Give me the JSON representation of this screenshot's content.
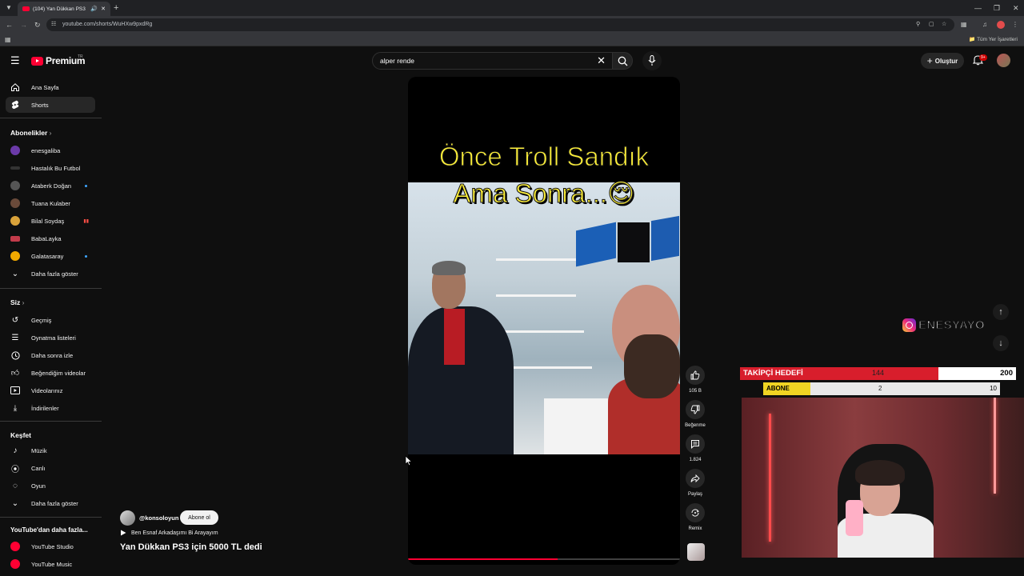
{
  "browser": {
    "tab_title": "(104) Yan Dükkan PS3 için 5",
    "url": "youtube.com/shorts/WuHXw9pxdRg",
    "bookmarks_all": "Tüm Yer İşaretleri"
  },
  "header": {
    "logo_text": "Premium",
    "country": "TR",
    "search_query": "alper rende",
    "create_label": "Oluştur",
    "notifications_badge": "9+"
  },
  "sidebar": {
    "home": "Ana Sayfa",
    "shorts": "Shorts",
    "subscriptions_title": "Abonelikler",
    "subscriptions": [
      {
        "name": "enesgaliba",
        "color": "#6b3aa8"
      },
      {
        "name": "Hastalık Bu Futbol",
        "color": "#333333"
      },
      {
        "name": "Ataberk Doğan",
        "color": "#444444"
      },
      {
        "name": "Tuana Kulaber",
        "color": "#6a4a3a"
      },
      {
        "name": "Bilal Soydaş",
        "color": "#d9a23a"
      },
      {
        "name": "BabaLayka",
        "color": "#c23b4a"
      },
      {
        "name": "Galatasaray",
        "color": "#f2a900"
      }
    ],
    "show_more": "Daha fazla göster",
    "you_title": "Siz",
    "you_items": [
      "Geçmiş",
      "Oynatma listeleri",
      "Daha sonra izle",
      "Beğendiğim videolar",
      "Videolarınız",
      "İndirilenler"
    ],
    "explore_title": "Keşfet",
    "explore_items": [
      "Müzik",
      "Canlı",
      "Oyun"
    ],
    "explore_more": "Daha fazla göster",
    "more_title": "YouTube'dan daha fazla...",
    "more_items": [
      "YouTube Studio",
      "YouTube Music"
    ]
  },
  "short": {
    "caption_line1": "Önce Troll Sandık",
    "caption_line2": "Ama Sonra...😌",
    "progress_fraction": 0.55,
    "channel": "@konsoloyun",
    "subscribe_label": "Abone ol",
    "sound": "Ben Esnaf Arkadaşımı Bi Arayayım",
    "title": "Yan Dükkan PS3 için 5000 TL dedi"
  },
  "actions": {
    "likes": "105 B",
    "dislike": "Beğenme",
    "comments": "1.824",
    "share": "Paylaş",
    "remix": "Remix"
  },
  "overlay": {
    "instagram_handle": "ENESYAYO",
    "follower_goal_label": "TAKİPÇİ HEDEFİ",
    "follower_current": "144",
    "follower_target": "200",
    "follower_fraction": 0.72,
    "sub_goal_label": "ABONE",
    "sub_current": "2",
    "sub_target": "10",
    "sub_fraction": 0.2
  }
}
